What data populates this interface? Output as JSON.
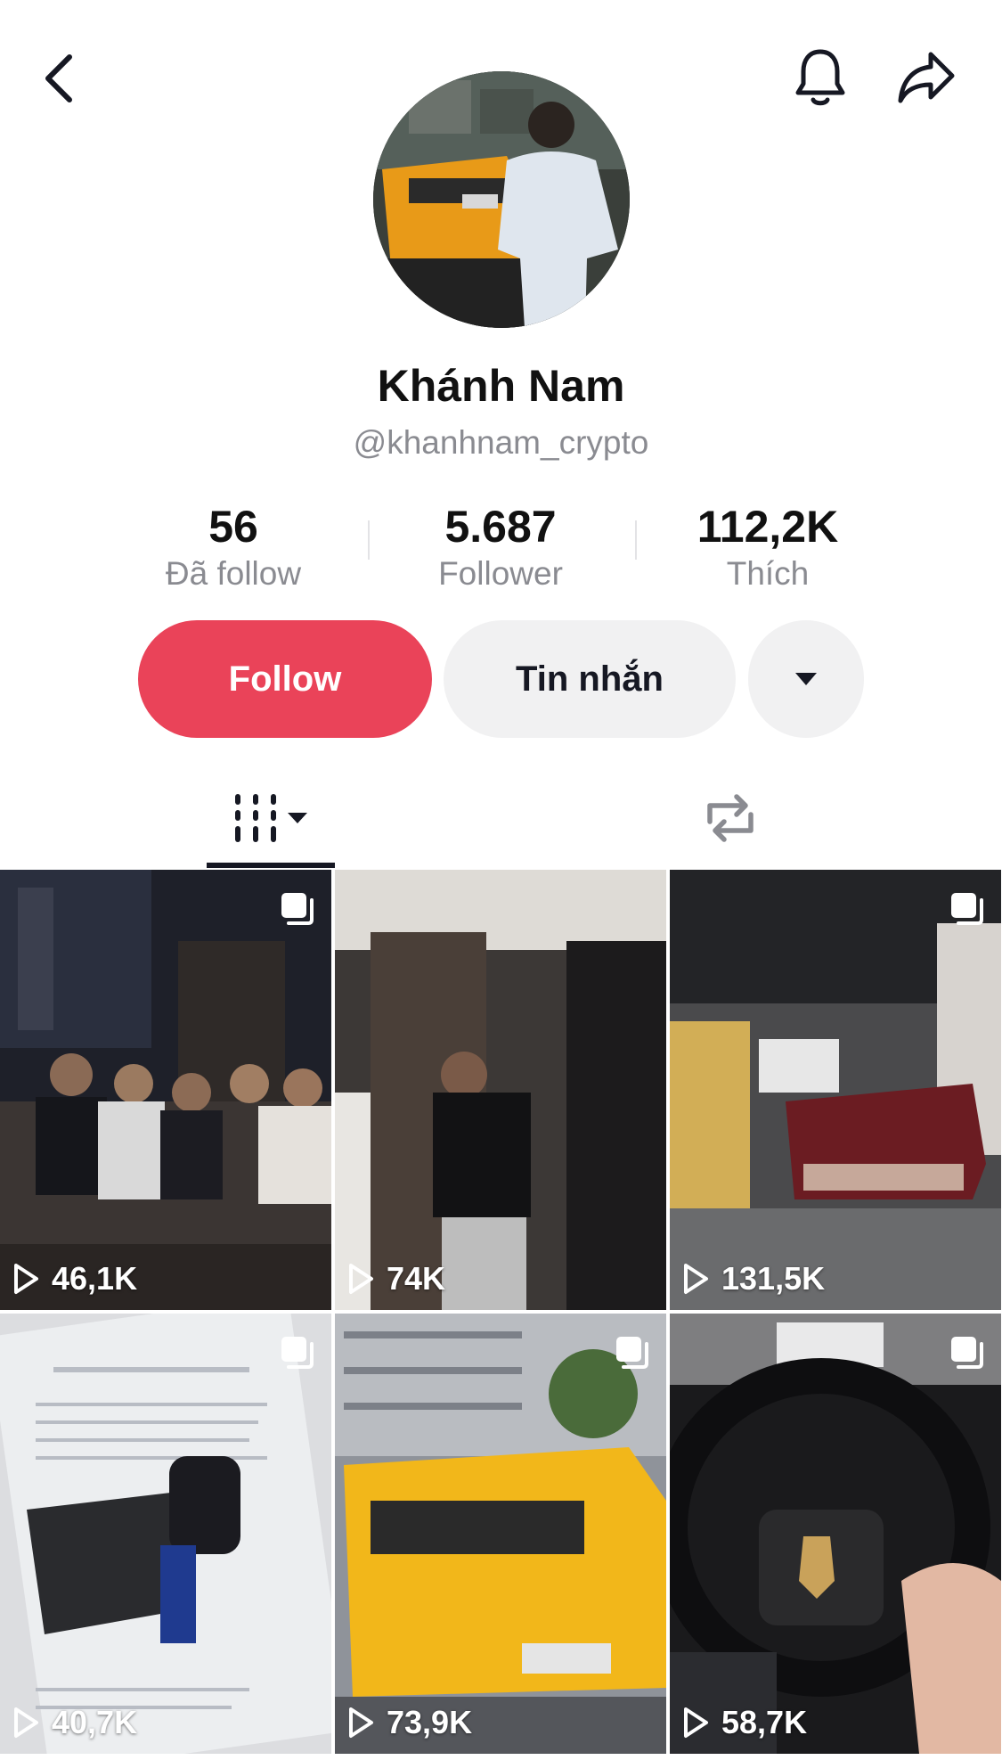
{
  "profile": {
    "display_name": "Khánh Nam",
    "username": "@khanhnam_crypto"
  },
  "stats": [
    {
      "value": "56",
      "label": "Đã follow"
    },
    {
      "value": "5.687",
      "label": "Follower"
    },
    {
      "value": "112,2K",
      "label": "Thích"
    }
  ],
  "actions": {
    "follow_label": "Follow",
    "message_label": "Tin nhắn"
  },
  "icons": {
    "back": "chevron-left-icon",
    "notifications": "bell-icon",
    "share": "share-arrow-icon",
    "more": "caret-down-icon",
    "videos_tab": "video-grid-icon",
    "reposts_tab": "repost-icon",
    "play": "play-icon",
    "multi_photo": "photo-stack-icon"
  },
  "colors": {
    "follow_button": "#ea4359",
    "secondary_button": "#f1f1f2",
    "muted_text": "#8a8b91"
  },
  "videos": [
    {
      "views": "46,1K"
    },
    {
      "views": "74K"
    },
    {
      "views": "131,5K"
    },
    {
      "views": "40,7K"
    },
    {
      "views": "73,9K"
    },
    {
      "views": "58,7K"
    }
  ]
}
